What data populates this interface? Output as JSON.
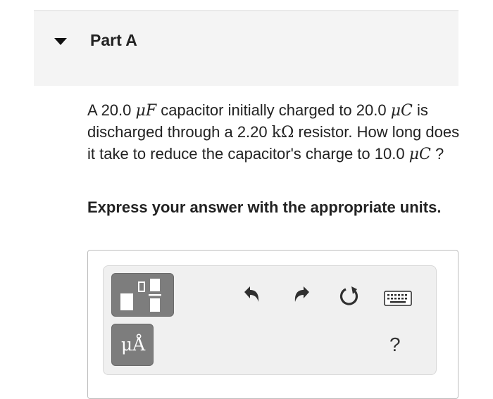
{
  "part": {
    "title": "Part A"
  },
  "question": {
    "t1": "A 20.0 ",
    "m1": "μF",
    "t2": " capacitor initially charged to 20.0 ",
    "m2": "μC",
    "t3": " is discharged through a 2.20 ",
    "m3": "kΩ",
    "t4": " resistor. How long does it take to reduce the capacitor's charge to 10.0 ",
    "m4": "μC",
    "t5": " ?"
  },
  "instruction": "Express your answer with the appropriate units.",
  "toolbar": {
    "units_label": "μÅ",
    "help_label": "?"
  }
}
